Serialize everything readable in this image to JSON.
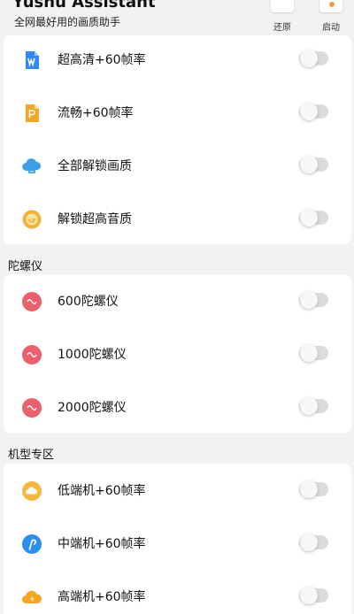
{
  "header": {
    "title": "Yushu Assistant",
    "subtitle": "全网最好用的画质助手",
    "restore_label": "还原",
    "start_label": "启动"
  },
  "groups": [
    {
      "title": "",
      "items": [
        {
          "label": "超高清+60帧率",
          "icon": "word-doc-icon",
          "enabled": false
        },
        {
          "label": "流畅+60帧率",
          "icon": "slides-doc-icon",
          "enabled": false
        },
        {
          "label": "全部解锁画质",
          "icon": "cloud-icon",
          "enabled": false
        },
        {
          "label": "解锁超高音质",
          "icon": "music-icon",
          "enabled": false
        }
      ]
    },
    {
      "title": "陀螺仪",
      "items": [
        {
          "label": "600陀螺仪",
          "icon": "gyro-icon",
          "enabled": false
        },
        {
          "label": "1000陀螺仪",
          "icon": "gyro-icon",
          "enabled": false
        },
        {
          "label": "2000陀螺仪",
          "icon": "gyro-icon",
          "enabled": false
        }
      ]
    },
    {
      "title": "机型专区",
      "items": [
        {
          "label": "低端机+60帧率",
          "icon": "weather-cloud-icon",
          "enabled": false
        },
        {
          "label": "中端机+60帧率",
          "icon": "pen-icon",
          "enabled": false
        },
        {
          "label": "高端机+60帧率",
          "icon": "cloud-bolt-icon",
          "enabled": false
        }
      ]
    }
  ],
  "colors": {
    "background": "#f2f2f4",
    "card": "#ffffff",
    "toggle_off": "#dcdcdc"
  }
}
